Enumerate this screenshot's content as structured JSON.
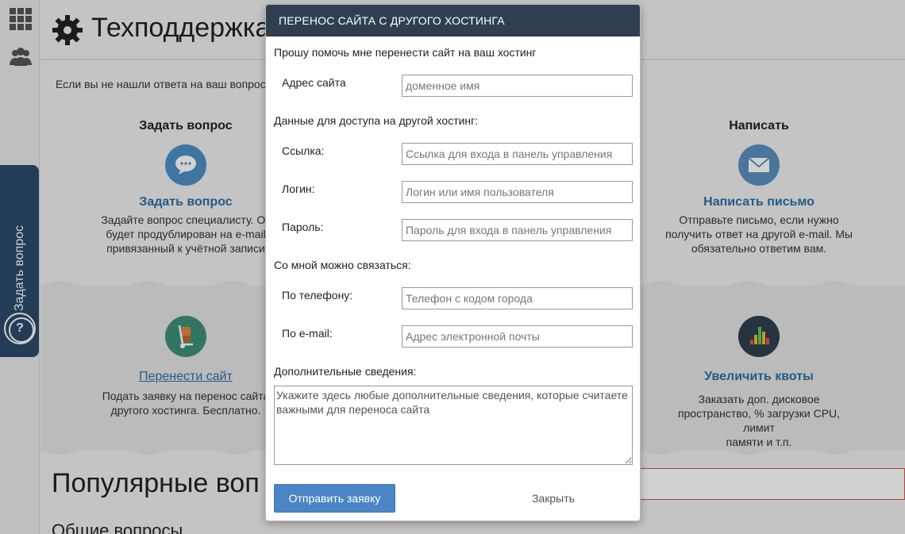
{
  "page": {
    "title": "Техподдержка",
    "intro": "Если вы не нашли ответа на ваш вопрос",
    "side_tab_label": "Задать вопрос",
    "side_tab_icon": "question-icon",
    "columns": [
      {
        "head": "Задать вопрос",
        "icon": "speech-bubble-icon",
        "color": "#4f8fc5",
        "link": "Задать вопрос",
        "text": [
          "Задайте вопрос специалисту. От",
          "будет продублирован на e-mail",
          "привязанный к учётной записи"
        ]
      },
      {
        "head": "Написать",
        "icon": "envelope-icon",
        "color": "#5b8fc0",
        "link": "Написать письмо",
        "text": [
          "Отправьте письмо, если нужно",
          "получить ответ на другой e-mail. Мы",
          "обязательно ответим вам."
        ]
      },
      {
        "head": "",
        "icon": "hand-truck-icon",
        "color": "#3f8f7a",
        "link": "Перенести сайт",
        "text": [
          "Подать заявку на перенос сайта",
          "другого хостинга. Бесплатно."
        ]
      },
      {
        "head": "",
        "icon": "quota-bars-icon",
        "color": "#2f3f50",
        "link": "Увеличить квоты",
        "text": [
          "Заказать доп. дисковое",
          "пространство, % загрузки CPU, лимит",
          "памяти и т.п."
        ]
      }
    ],
    "popular": "Популярные воп",
    "common": "Общие вопросы"
  },
  "modal": {
    "title": "ПЕРЕНОС САЙТА С ДРУГОГО ХОСТИНГА",
    "intro": "Прошу помочь мне перенести сайт на ваш хостинг",
    "site_label": "Адрес сайта",
    "site_placeholder": "доменное имя",
    "access_heading": "Данные для доступа на другой хостинг:",
    "link_label": "Ссылка:",
    "link_placeholder": "Ссылка для входа в панель управления",
    "login_label": "Логин:",
    "login_placeholder": "Логин или имя пользователя",
    "password_label": "Пароль:",
    "password_placeholder": "Пароль для входа в панель управления",
    "contact_heading": "Со мной можно связаться:",
    "phone_label": "По телефону:",
    "phone_placeholder": "Телефон с кодом города",
    "email_label": "По e-mail:",
    "email_placeholder": "Адрес электронной почты",
    "extra_heading": "Дополнительные сведения:",
    "extra_placeholder": "Укажите здесь любые дополнительные сведения, которые считаете важными для переноса сайта",
    "submit_label": "Отправить заявку",
    "close_label": "Закрыть"
  }
}
